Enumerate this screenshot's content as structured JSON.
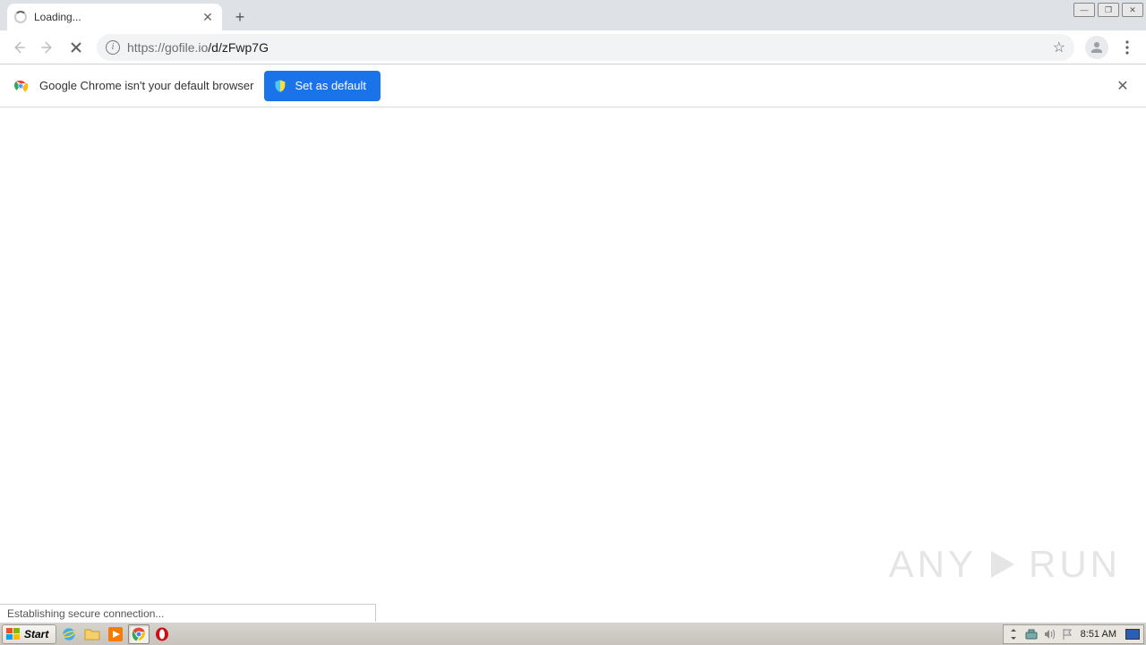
{
  "tab": {
    "title": "Loading..."
  },
  "address": {
    "url_prefix": "https://gofile.io",
    "url_path": "/d/zFwp7G"
  },
  "infobar": {
    "message": "Google Chrome isn't your default browser",
    "button_label": "Set as default"
  },
  "status": {
    "text": "Establishing secure connection..."
  },
  "watermark": {
    "left": "ANY",
    "right": "RUN"
  },
  "taskbar": {
    "start_label": "Start",
    "clock": "8:51 AM"
  }
}
